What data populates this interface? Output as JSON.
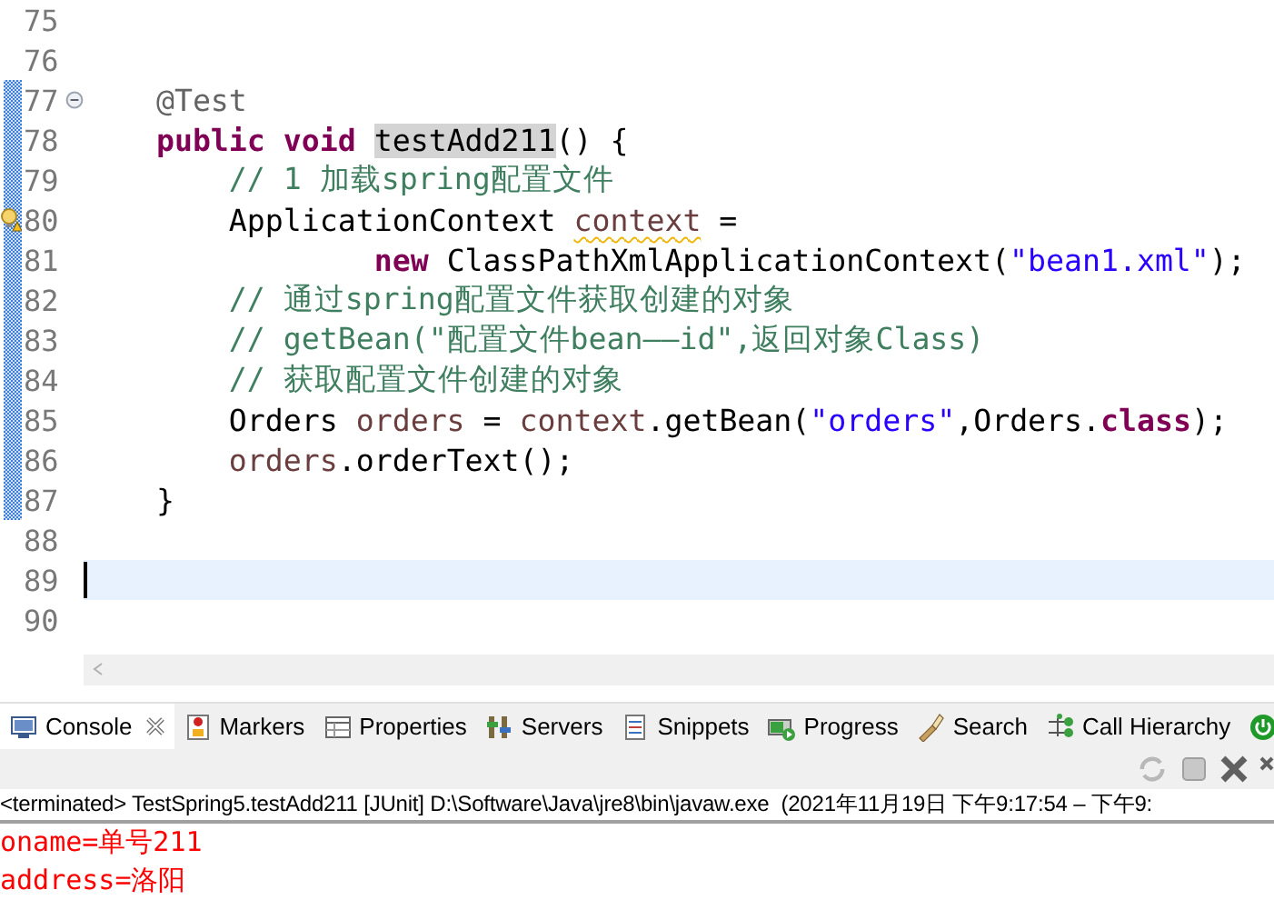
{
  "editor": {
    "lines": [
      {
        "number": "75",
        "changed": false,
        "current": false,
        "kind": "code"
      },
      {
        "number": "76",
        "changed": false,
        "current": false,
        "kind": "code"
      },
      {
        "number": "77",
        "tokens": [
          {
            "kind": "annotation",
            "text": "    @Test"
          }
        ],
        "changed": true,
        "current": false,
        "kind": "fold-start"
      },
      {
        "number": "78",
        "tokens": [
          {
            "kind": "keyword",
            "text": "    public void "
          },
          {
            "kind": "highlight",
            "text": "testAdd211"
          },
          {
            "kind": "plain",
            "text": "() {"
          }
        ],
        "changed": true,
        "current": false,
        "kind": "code"
      },
      {
        "number": "79",
        "tokens": [
          {
            "kind": "comment",
            "text": "        // 1 加载spring配置文件"
          }
        ],
        "changed": true,
        "current": false,
        "kind": "code"
      },
      {
        "number": "80",
        "tokens": [
          {
            "kind": "plain",
            "text": "        ApplicationContext "
          },
          {
            "kind": "local-warning",
            "text": "context"
          },
          {
            "kind": "plain",
            "text": " ="
          }
        ],
        "changed": true,
        "current": false,
        "kind": "warning"
      },
      {
        "number": "81",
        "tokens": [
          {
            "kind": "keyword",
            "text": "                new "
          },
          {
            "kind": "plain",
            "text": "ClassPathXmlApplicationContext("
          },
          {
            "kind": "string",
            "text": "\"bean1.xml\""
          },
          {
            "kind": "plain",
            "text": ");"
          }
        ],
        "changed": true,
        "current": false,
        "kind": "code"
      },
      {
        "number": "82",
        "tokens": [
          {
            "kind": "comment",
            "text": "        // 通过spring配置文件获取创建的对象"
          }
        ],
        "changed": true,
        "current": false,
        "kind": "code"
      },
      {
        "number": "83",
        "tokens": [
          {
            "kind": "comment",
            "text": "        // getBean(\"配置文件bean——id\",返回对象Class)"
          }
        ],
        "changed": true,
        "current": false,
        "kind": "code"
      },
      {
        "number": "84",
        "tokens": [
          {
            "kind": "comment",
            "text": "        // 获取配置文件创建的对象"
          }
        ],
        "changed": true,
        "current": false,
        "kind": "code"
      },
      {
        "number": "85",
        "tokens": [
          {
            "kind": "plain",
            "text": "        Orders "
          },
          {
            "kind": "local",
            "text": "orders"
          },
          {
            "kind": "plain",
            "text": " = "
          },
          {
            "kind": "local",
            "text": "context"
          },
          {
            "kind": "plain",
            "text": ".getBean("
          },
          {
            "kind": "string",
            "text": "\"orders\""
          },
          {
            "kind": "plain",
            "text": ",Orders."
          },
          {
            "kind": "keyword",
            "text": "class"
          },
          {
            "kind": "plain",
            "text": ");"
          }
        ],
        "changed": true,
        "current": false,
        "kind": "code"
      },
      {
        "number": "86",
        "tokens": [
          {
            "kind": "local",
            "text": "        orders"
          },
          {
            "kind": "plain",
            "text": ".orderText();"
          }
        ],
        "changed": true,
        "current": false,
        "kind": "code"
      },
      {
        "number": "87",
        "tokens": [
          {
            "kind": "plain",
            "text": "    }"
          }
        ],
        "changed": true,
        "current": false,
        "kind": "code"
      },
      {
        "number": "88",
        "changed": false,
        "current": false,
        "kind": "code"
      },
      {
        "number": "89",
        "changed": false,
        "current": true,
        "kind": "code"
      },
      {
        "number": "90",
        "changed": false,
        "current": false,
        "kind": "code"
      }
    ]
  },
  "views": {
    "tabs": [
      {
        "kind": "console",
        "label": "Console",
        "selected": true
      },
      {
        "kind": "markers",
        "label": "Markers",
        "selected": false
      },
      {
        "kind": "properties",
        "label": "Properties",
        "selected": false
      },
      {
        "kind": "servers",
        "label": "Servers",
        "selected": false
      },
      {
        "kind": "snippets",
        "label": "Snippets",
        "selected": false
      },
      {
        "kind": "progress",
        "label": "Progress",
        "selected": false
      },
      {
        "kind": "search",
        "label": "Search",
        "selected": false
      },
      {
        "kind": "hierarchy",
        "label": "Call Hierarchy",
        "selected": false
      },
      {
        "kind": "junit",
        "selected": false
      }
    ],
    "toolbar": [
      {
        "kind": "sync",
        "disabled": true
      },
      {
        "kind": "stop",
        "disabled": true
      },
      {
        "kind": "remove",
        "disabled": false
      },
      {
        "kind": "remove-all",
        "disabled": false
      }
    ]
  },
  "console": {
    "status": "<terminated> TestSpring5.testAdd211 [JUnit] D:\\Software\\Java\\jre8\\bin\\javaw.exe  (2021年11月19日 下午9:17:54 – 下午9:",
    "output": [
      {
        "kind": "error",
        "text": "oname=单号211"
      },
      {
        "kind": "error",
        "text": "address=洛阳"
      }
    ]
  }
}
